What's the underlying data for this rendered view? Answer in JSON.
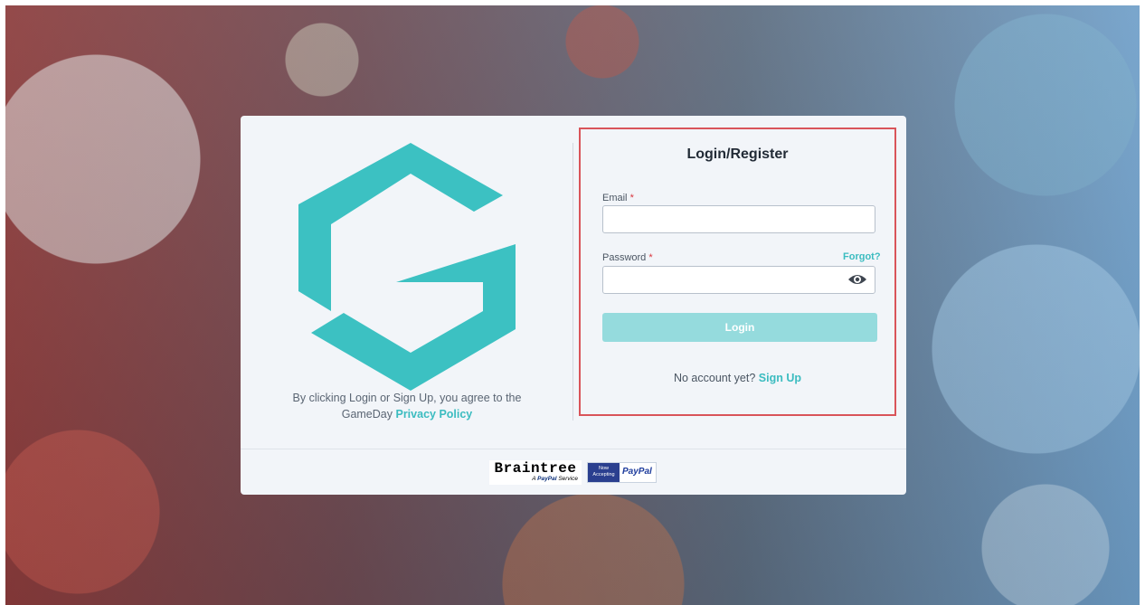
{
  "login": {
    "title": "Login/Register",
    "email_label": "Email",
    "password_label": "Password",
    "required_mark": "*",
    "forgot_label": "Forgot?",
    "email_value": "",
    "password_value": "",
    "login_button": "Login",
    "no_account_text": "No account yet?",
    "signup_link": "Sign Up"
  },
  "left_panel": {
    "agree_text": "By clicking Login or Sign Up, you agree to the",
    "brand": "GameDay",
    "privacy_link": "Privacy Policy"
  },
  "footer": {
    "braintree_name": "Braintree",
    "braintree_sub_prefix": "A",
    "braintree_sub_brand": "PayPal",
    "braintree_sub_suffix": "Service",
    "now_accepting_line1": "Now",
    "now_accepting_line2": "Accepting",
    "paypal_label": "PayPal"
  },
  "icons": {
    "logo": "gameday-g-logo",
    "password_toggle": "eye-icon"
  },
  "colors": {
    "accent": "#3bbcc0",
    "login_button": "#95dbdd",
    "highlight_border": "#d9545a",
    "card_bg": "#f2f5f9"
  }
}
